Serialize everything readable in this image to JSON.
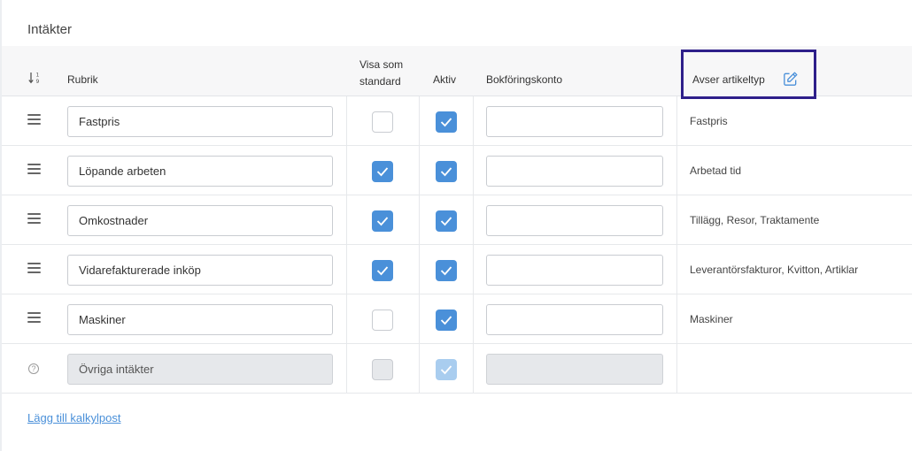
{
  "section": {
    "title": "Intäkter"
  },
  "table": {
    "headers": {
      "sort_icon": "sort-numeric-icon",
      "rubrik": "Rubrik",
      "visa_line1": "Visa som",
      "visa_line2": "standard",
      "aktiv": "Aktiv",
      "bokforingskonto": "Bokföringskonto",
      "avser_artikeltyp": "Avser artikeltyp",
      "edit_icon": "edit-icon"
    },
    "rows": [
      {
        "rubrik": "Fastpris",
        "visa_som_standard": false,
        "aktiv": true,
        "bokforingskonto": "",
        "artikeltyp": "Fastpris"
      },
      {
        "rubrik": "Löpande arbeten",
        "visa_som_standard": true,
        "aktiv": true,
        "bokforingskonto": "",
        "artikeltyp": "Arbetad tid"
      },
      {
        "rubrik": "Omkostnader",
        "visa_som_standard": true,
        "aktiv": true,
        "bokforingskonto": "",
        "artikeltyp": "Tillägg, Resor, Traktamente"
      },
      {
        "rubrik": "Vidarefakturerade inköp",
        "visa_som_standard": true,
        "aktiv": true,
        "bokforingskonto": "",
        "artikeltyp": "Leverantörsfakturor, Kvitton, Artiklar"
      },
      {
        "rubrik": "Maskiner",
        "visa_som_standard": false,
        "aktiv": true,
        "bokforingskonto": "",
        "artikeltyp": "Maskiner"
      }
    ],
    "locked_row": {
      "rubrik": "Övriga intäkter",
      "visa_som_standard": false,
      "aktiv": true,
      "bokforingskonto": "",
      "artikeltyp": "",
      "icon": "help-circle-icon"
    }
  },
  "actions": {
    "add_link": "Lägg till kalkylpost"
  },
  "colors": {
    "accent": "#4a90d9",
    "highlight_border": "#2e1f8a",
    "header_bg": "#f7f7f8"
  }
}
